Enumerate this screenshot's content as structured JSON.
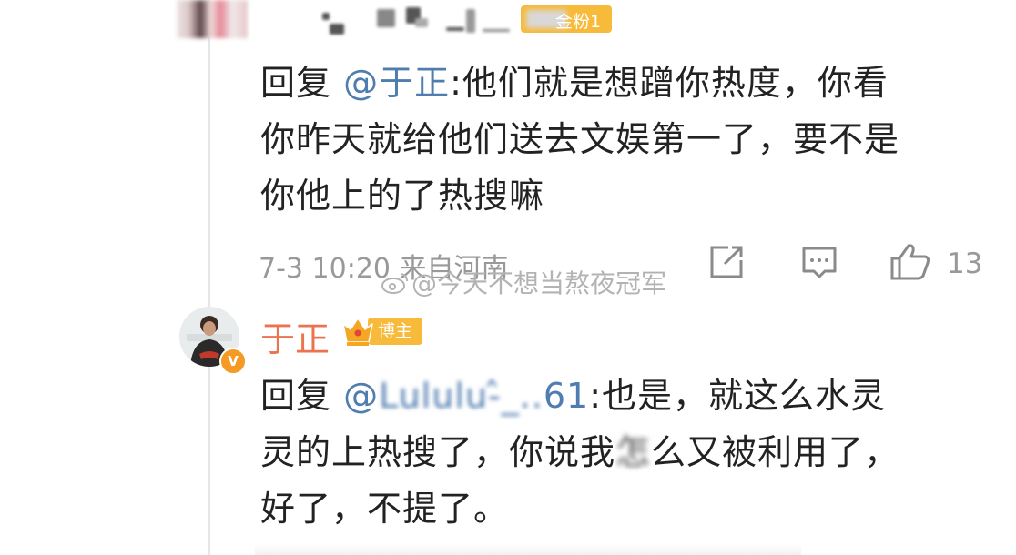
{
  "comment1": {
    "fan_badge": "金粉1",
    "reply_prefix": "回复 ",
    "mention": "@于正",
    "text_line1": ":他们就是想蹭你热度，你看",
    "text_line2": "你昨天就给他们送去文娱第一了，要不是",
    "text_line3": "你他上的了热搜嘛",
    "timestamp": "7-3 10:20",
    "location": "来自河南",
    "like_count": "13"
  },
  "watermark": "@今天不想当熬夜冠军",
  "reply": {
    "author": "于正",
    "badge": "博主",
    "reply_prefix": "回复 ",
    "mention": "@",
    "mention_suffix": "61",
    "text_line1": ":也是，就这么水灵",
    "text_line2_a": "灵的上热搜了，你说我",
    "text_line2_b": "怎",
    "text_line2_c": "么又被利用了，",
    "text_line3": "好了，不提了。"
  },
  "colors": {
    "mention": "#507daf",
    "author": "#eb7350",
    "badge": "#f7ba3b",
    "meta": "#999999"
  },
  "icons": {
    "share": "share-icon",
    "comment": "comment-icon",
    "like": "like-icon",
    "crown": "crown-icon",
    "verified": "verified-icon"
  }
}
